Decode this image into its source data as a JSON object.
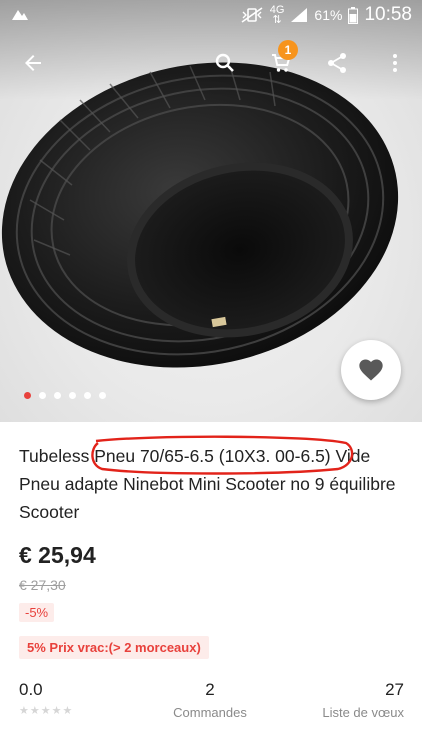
{
  "status_bar": {
    "network": "4G",
    "network_sub": "⇅",
    "battery_percent": "61%",
    "time": "10:58"
  },
  "toolbar": {
    "icons": [
      "back-arrow-icon",
      "search-icon",
      "cart-icon",
      "share-icon",
      "more-vert-icon"
    ],
    "cart_badge": "1"
  },
  "gallery": {
    "image_count": 6,
    "active_index": 0
  },
  "product": {
    "title": "Tubeless Pneu 70/65-6.5 (10X3. 00-6.5) Vide Pneu adapte Ninebot Mini Scooter no 9 équilibre Scooter",
    "price": "€ 25,94",
    "original_price": "€ 27,30",
    "discount": "-5%",
    "bulk_price": "5% Prix vrac:(> 2 morceaux)"
  },
  "stats": {
    "rating": "0.0",
    "stars_filled": 0,
    "stars_total": 5,
    "orders_count": "2",
    "orders_label": "Commandes",
    "wishlist_count": "27",
    "wishlist_label": "Liste de vœux"
  },
  "colors": {
    "accent": "#e8413c",
    "badge": "#f7941d",
    "text": "#222222",
    "muted": "#8a8a8a"
  }
}
